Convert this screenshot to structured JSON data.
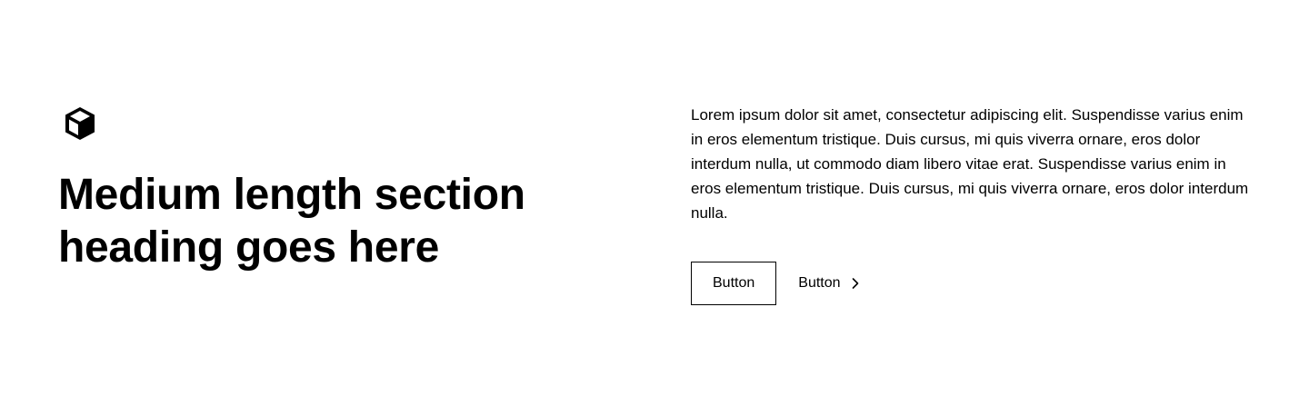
{
  "section": {
    "logo_icon": "cube-icon",
    "heading": "Medium length section\nheading goes here",
    "body_text": "Lorem ipsum dolor sit amet, consectetur adipiscing elit. Suspendisse varius enim in eros elementum tristique. Duis cursus, mi quis viverra ornare, eros dolor interdum nulla, ut commodo diam libero vitae erat. Suspendisse varius enim in eros elementum tristique. Duis cursus, mi quis viverra ornare, eros dolor interdum nulla.",
    "primary_button_label": "Button",
    "secondary_button_label": "Button",
    "secondary_button_icon": "chevron-right-icon"
  },
  "colors": {
    "text": "#000000",
    "background": "#ffffff",
    "border": "#000000"
  }
}
